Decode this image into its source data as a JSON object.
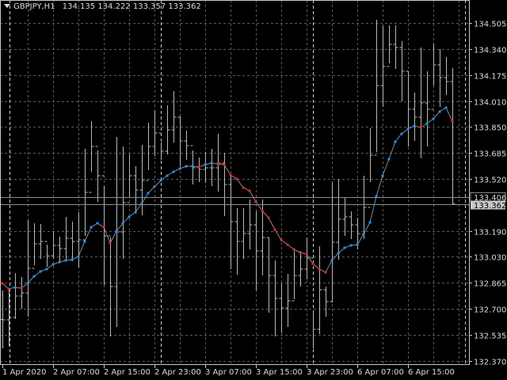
{
  "header": {
    "symbol": "GBPJPY,H1",
    "open": "134.135",
    "high": "134.222",
    "low": "133.357",
    "close": "133.362"
  },
  "colors": {
    "background": "#000000",
    "bars": "#b8b8b8",
    "grid": "#5a5a5a",
    "ma_up": "#1e90ff",
    "ma_down": "#ff2020",
    "ma_line": "#8a8a8a"
  },
  "price_axis": {
    "ticks": [
      "134.505",
      "134.340",
      "134.175",
      "134.010",
      "133.850",
      "133.685",
      "133.520",
      "133.190",
      "133.030",
      "132.865",
      "132.700",
      "132.535",
      "132.370"
    ],
    "ask_label": "133.406",
    "bid_label": "133.362"
  },
  "time_axis": {
    "labels": [
      "1 Apr 2020",
      "2 Apr 07:00",
      "2 Apr 15:00",
      "2 Apr 23:00",
      "3 Apr 07:00",
      "3 Apr 15:00",
      "3 Apr 23:00",
      "6 Apr 07:00",
      "6 Apr 15:00"
    ]
  },
  "chart_data": {
    "type": "ohlc",
    "symbol": "GBPJPY",
    "timeframe": "H1",
    "ylim": [
      132.37,
      134.65
    ],
    "high": [
      132.815,
      132.825,
      132.925,
      132.9,
      133.26,
      133.24,
      133.235,
      133.105,
      133.19,
      133.155,
      133.28,
      133.25,
      133.31,
      133.71,
      133.885,
      133.7,
      133.475,
      133.15,
      133.785,
      133.725,
      133.675,
      133.6,
      133.735,
      133.875,
      133.95,
      133.75,
      133.985,
      134.075,
      133.915,
      133.825,
      133.7,
      133.655,
      133.69,
      133.71,
      133.805,
      133.685,
      133.55,
      133.335,
      133.335,
      133.39,
      133.315,
      133.39,
      133.15,
      133.005,
      132.86,
      132.92,
      133.065,
      133.065,
      133.15,
      132.69,
      133.095,
      132.84,
      133.5,
      133.52,
      133.4,
      133.315,
      133.275,
      133.54,
      133.84,
      134.525,
      134.485,
      134.49,
      134.49,
      134.39,
      134.2,
      134.065,
      134.35,
      134.2,
      134.375,
      134.34,
      134.29,
      134.222
    ],
    "low": [
      132.45,
      132.465,
      132.635,
      132.7,
      132.65,
      132.975,
      133.015,
      132.965,
      133.015,
      133.0,
      133.01,
      133.0,
      132.96,
      133.16,
      133.565,
      133.375,
      132.85,
      132.525,
      132.585,
      133.015,
      133.4,
      133.3,
      133.29,
      133.575,
      133.665,
      133.64,
      133.675,
      133.75,
      133.6,
      133.64,
      133.485,
      133.5,
      133.495,
      133.475,
      133.44,
      133.285,
      132.95,
      132.915,
      133.015,
      133.075,
      132.815,
      132.91,
      132.675,
      132.525,
      132.55,
      132.585,
      132.76,
      132.84,
      132.885,
      132.45,
      132.54,
      132.65,
      132.74,
      133.01,
      133.16,
      133.14,
      133.075,
      133.14,
      133.5,
      133.69,
      133.975,
      134.25,
      134.215,
      134.01,
      133.725,
      133.76,
      133.65,
      133.725,
      134.11,
      133.975,
      134.05,
      133.357
    ],
    "close": [
      132.63,
      132.645,
      132.78,
      132.8,
      132.955,
      133.11,
      133.125,
      133.035,
      133.1,
      133.08,
      133.145,
      133.125,
      133.135,
      133.435,
      133.725,
      133.54,
      133.16,
      132.84,
      133.185,
      133.37,
      133.54,
      133.45,
      133.51,
      133.725,
      133.81,
      133.695,
      133.83,
      133.91,
      133.76,
      133.73,
      133.59,
      133.58,
      133.59,
      133.59,
      133.62,
      133.485,
      133.25,
      133.125,
      133.175,
      133.23,
      133.065,
      133.15,
      132.91,
      132.765,
      132.705,
      132.75,
      132.91,
      132.95,
      133.02,
      132.57,
      132.82,
      132.745,
      133.12,
      133.265,
      133.28,
      133.23,
      133.175,
      133.34,
      133.67,
      134.11,
      134.23,
      134.37,
      134.35,
      134.2,
      133.96,
      133.91,
      134.0,
      133.96,
      134.24,
      134.16,
      134.135,
      133.362
    ],
    "last_open": 134.135,
    "moving_average": [
      132.86,
      132.825,
      132.835,
      132.83,
      132.86,
      132.905,
      132.935,
      132.95,
      132.98,
      132.995,
      133.005,
      133.01,
      133.03,
      133.125,
      133.215,
      133.24,
      133.215,
      133.115,
      133.19,
      133.24,
      133.28,
      133.31,
      133.365,
      133.43,
      133.47,
      133.51,
      133.54,
      133.565,
      133.585,
      133.6,
      133.6,
      133.595,
      133.61,
      133.62,
      133.615,
      133.61,
      133.545,
      133.52,
      133.465,
      133.445,
      133.375,
      133.32,
      133.275,
      133.2,
      133.135,
      133.105,
      133.075,
      133.055,
      133.045,
      132.985,
      132.95,
      132.93,
      133.005,
      133.05,
      133.085,
      133.1,
      133.105,
      133.17,
      133.245,
      133.41,
      133.54,
      133.645,
      133.755,
      133.805,
      133.835,
      133.855,
      133.845,
      133.87,
      133.9,
      133.945,
      133.97,
      133.885
    ],
    "ask": 133.406,
    "bid": 133.362
  }
}
